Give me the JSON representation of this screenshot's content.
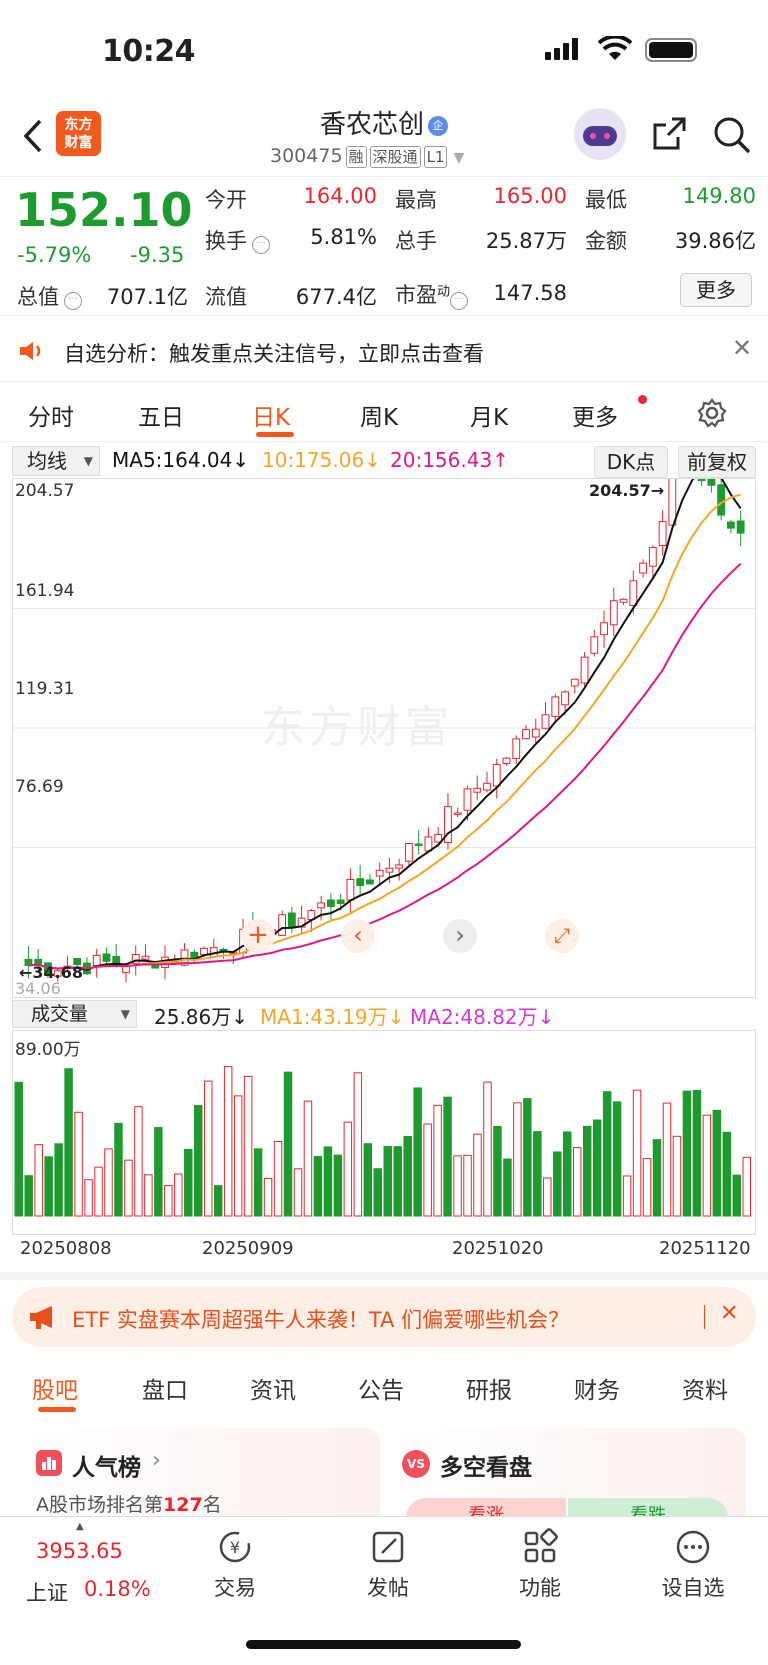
{
  "status": {
    "time": "10:24"
  },
  "header": {
    "logo": "东方财富",
    "title": "香农芯创",
    "badge": "企",
    "code": "300475",
    "tags": [
      "融",
      "深股通",
      "L1"
    ]
  },
  "quote": {
    "price": "152.10",
    "pct": "-5.79%",
    "chg": "-9.35",
    "rows": [
      [
        {
          "l": "今开",
          "v": "164.00",
          "c": "red"
        },
        {
          "l": "最高",
          "v": "165.00",
          "c": "red"
        },
        {
          "l": "最低",
          "v": "149.80",
          "c": "green"
        }
      ],
      [
        {
          "l": "换手",
          "v": "5.81%",
          "c": ""
        },
        {
          "l": "总手",
          "v": "25.87万",
          "c": ""
        },
        {
          "l": "金额",
          "v": "39.86亿",
          "c": ""
        }
      ],
      [
        {
          "l": "总值",
          "v": "707.1亿",
          "c": ""
        },
        {
          "l": "流值",
          "v": "677.4亿",
          "c": ""
        },
        {
          "l": "市盈",
          "sup": "动",
          "v": "147.58",
          "c": ""
        }
      ]
    ],
    "more": "更多"
  },
  "notice": {
    "text": "自选分析：触发重点关注信号，立即点击查看"
  },
  "tabs": {
    "items": [
      "分时",
      "五日",
      "日K",
      "周K",
      "月K",
      "更多"
    ],
    "active": "日K"
  },
  "ma": {
    "selector": "均线",
    "ma5": "MA5:164.04↓",
    "ma10": "10:175.06↓",
    "ma20": "20:156.43↑",
    "dk": "DK点",
    "fq": "前复权",
    "colors": {
      "ma5": "#111111",
      "ma10": "#f5a623",
      "ma20": "#e0188a"
    }
  },
  "kline": {
    "yticks": [
      "204.57",
      "161.94",
      "119.31",
      "76.69",
      "34.06"
    ],
    "max_label": "204.57→",
    "min_label": "←34.68",
    "watermark": "东方财富",
    "ymin": 34.06,
    "ymax": 204.57
  },
  "volume": {
    "selector": "成交量",
    "val": "25.86万↓",
    "ma1": "MA1:43.19万↓",
    "ma2": "MA2:48.82万↓",
    "max": "89.00万",
    "dates": [
      "20250808",
      "20250909",
      "20251020",
      "20251120"
    ]
  },
  "banner": {
    "text": "ETF 实盘赛本周超强牛人来袭！TA 们偏爱哪些机会？"
  },
  "bottom_tabs": {
    "items": [
      "股吧",
      "盘口",
      "资讯",
      "公告",
      "研报",
      "财务",
      "资料"
    ],
    "active": "股吧"
  },
  "cards": {
    "rank_title": "人气榜",
    "rank_text_pre": "A股市场排名第",
    "rank_num": "127",
    "rank_text_post": "名",
    "vs_title": "多空看盘",
    "up": "看涨",
    "down": "看跌"
  },
  "bottomnav": {
    "index_value": "3953.65",
    "index_name": "上证",
    "index_pct": "0.18%",
    "items": [
      "交易",
      "发帖",
      "功能",
      "设自选"
    ]
  }
}
